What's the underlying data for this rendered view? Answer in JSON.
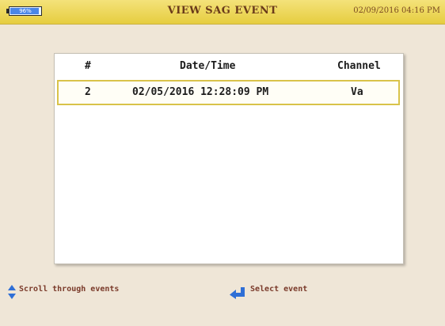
{
  "header": {
    "battery": {
      "icon": "battery-icon",
      "level_text": "96%",
      "level": 0.96
    },
    "title": "VIEW SAG EVENT",
    "datetime": "02/09/2016 04:16 PM"
  },
  "table": {
    "columns": {
      "index": "#",
      "datetime": "Date/Time",
      "channel": "Channel"
    },
    "rows": [
      {
        "index": "2",
        "datetime": "02/05/2016 12:28:09 PM",
        "channel": "Va",
        "selected": true
      }
    ]
  },
  "footer": {
    "scroll_hint": {
      "icon": "up-down-arrows-icon",
      "label": "Scroll through events"
    },
    "select_hint": {
      "icon": "enter-key-icon",
      "label": "Select event"
    }
  },
  "colors": {
    "titlebar": "#e6cd3f",
    "background": "#efe6d7",
    "selection_border": "#d9c34a",
    "accent_blue": "#2f6fd6",
    "footer_text": "#7a3a2a"
  }
}
